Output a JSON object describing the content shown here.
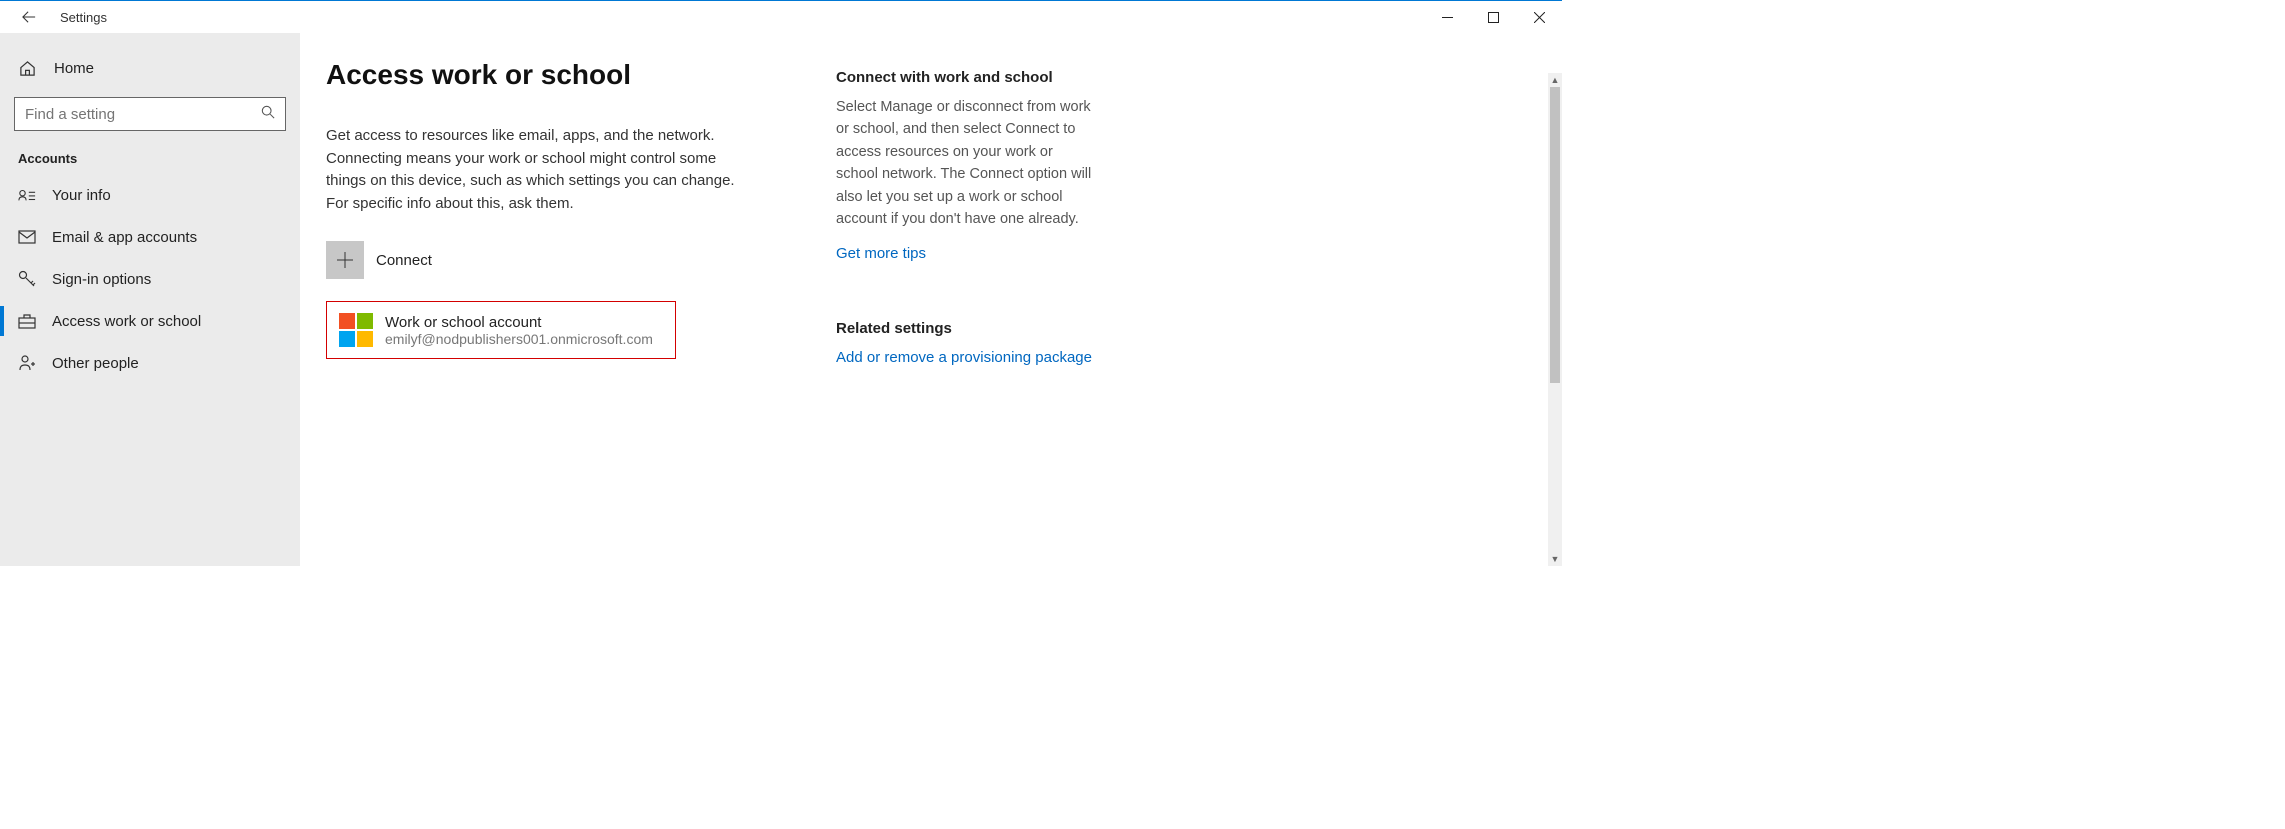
{
  "window": {
    "title": "Settings"
  },
  "sidebar": {
    "home_label": "Home",
    "search_placeholder": "Find a setting",
    "section_label": "Accounts",
    "items": [
      {
        "label": "Your info"
      },
      {
        "label": "Email & app accounts"
      },
      {
        "label": "Sign-in options"
      },
      {
        "label": "Access work or school"
      },
      {
        "label": "Other people"
      }
    ]
  },
  "main": {
    "title": "Access work or school",
    "description": "Get access to resources like email, apps, and the network. Connecting means your work or school might control some things on this device, such as which settings you can change. For specific info about this, ask them.",
    "connect_label": "Connect",
    "account": {
      "title": "Work or school account",
      "email": "emilyf@nodpublishers001.onmicrosoft.com"
    }
  },
  "aside": {
    "section1_title": "Connect with work and school",
    "section1_body": "Select Manage or disconnect from work or school, and then select Connect to access resources on your work or school network. The Connect option will also let you set up a work or school account if you don't have one already.",
    "link_tips": "Get more tips",
    "section2_title": "Related settings",
    "link_provisioning": "Add or remove a provisioning package"
  }
}
